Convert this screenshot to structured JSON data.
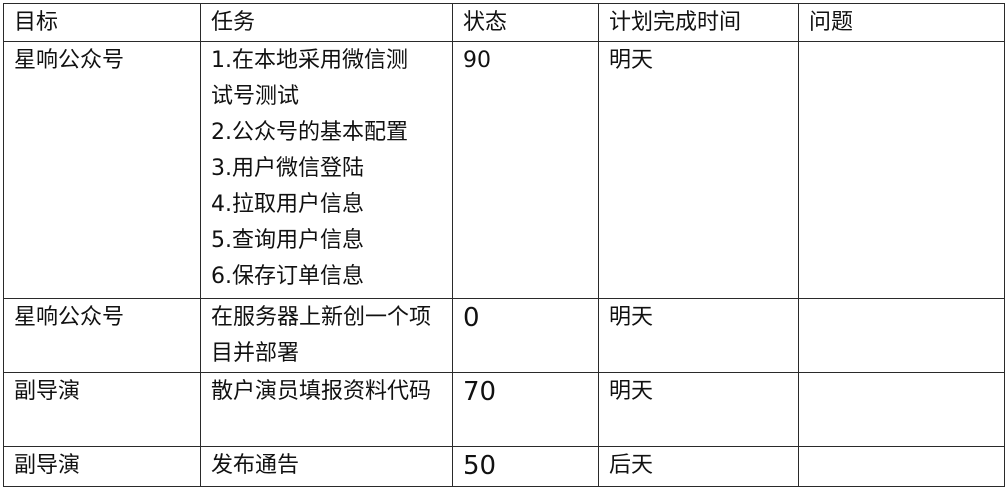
{
  "table": {
    "headers": {
      "goal": "目标",
      "task": "任务",
      "status": "状态",
      "plan": "计划完成时间",
      "issue": "问题"
    },
    "rows": [
      {
        "goal": "星响公众号",
        "task_lines": [
          "1.在本地采用微信测",
          "试号测试",
          "2.公众号的基本配置",
          "3.用户微信登陆",
          "4.拉取用户信息",
          "5.查询用户信息",
          "6.保存订单信息"
        ],
        "status": "90",
        "plan": "明天",
        "issue": ""
      },
      {
        "goal": "星响公众号",
        "task": "在服务器上新创一个项目并部署",
        "status": "0",
        "plan": "明天",
        "issue": ""
      },
      {
        "goal": "副导演",
        "task": "散户演员填报资料代码",
        "status": "70",
        "plan": "明天",
        "issue": ""
      },
      {
        "goal": "副导演",
        "task": "发布通告",
        "status": "50",
        "plan": "后天",
        "issue": ""
      }
    ]
  }
}
